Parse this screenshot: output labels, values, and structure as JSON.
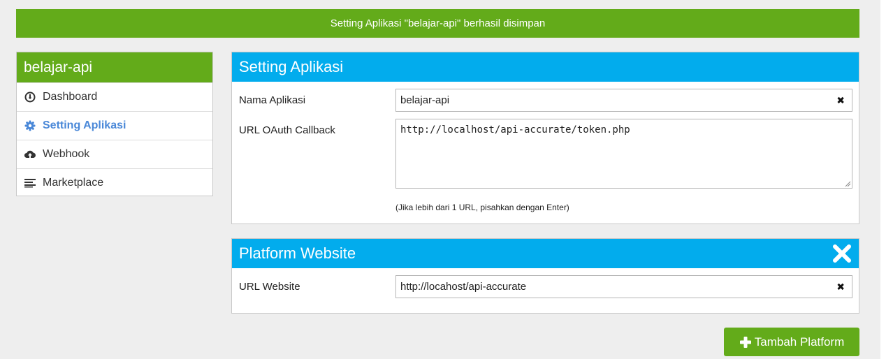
{
  "alert": {
    "message": "Setting Aplikasi \"belajar-api\" berhasil disimpan"
  },
  "sidebar": {
    "title": "belajar-api",
    "items": [
      {
        "label": "Dashboard",
        "icon": "dashboard-icon",
        "active": false
      },
      {
        "label": "Setting Aplikasi",
        "icon": "gear-icon",
        "active": true
      },
      {
        "label": "Webhook",
        "icon": "cloud-upload-icon",
        "active": false
      },
      {
        "label": "Marketplace",
        "icon": "list-icon",
        "active": false
      }
    ]
  },
  "settings_panel": {
    "title": "Setting Aplikasi",
    "app_name_label": "Nama Aplikasi",
    "app_name_value": "belajar-api",
    "callback_label": "URL OAuth Callback",
    "callback_value": "http://localhost/api-accurate/token.php",
    "callback_hint": "(Jika lebih dari 1 URL, pisahkan dengan Enter)"
  },
  "platform_panel": {
    "title": "Platform Website",
    "url_label": "URL Website",
    "url_value": "http://locahost/api-accurate"
  },
  "add_button": {
    "label": "Tambah Platform",
    "icon": "plus-icon"
  },
  "colors": {
    "green": "#63ab1a",
    "blue": "#02aced",
    "active_link": "#4a88d8",
    "background": "#eeeeee"
  }
}
